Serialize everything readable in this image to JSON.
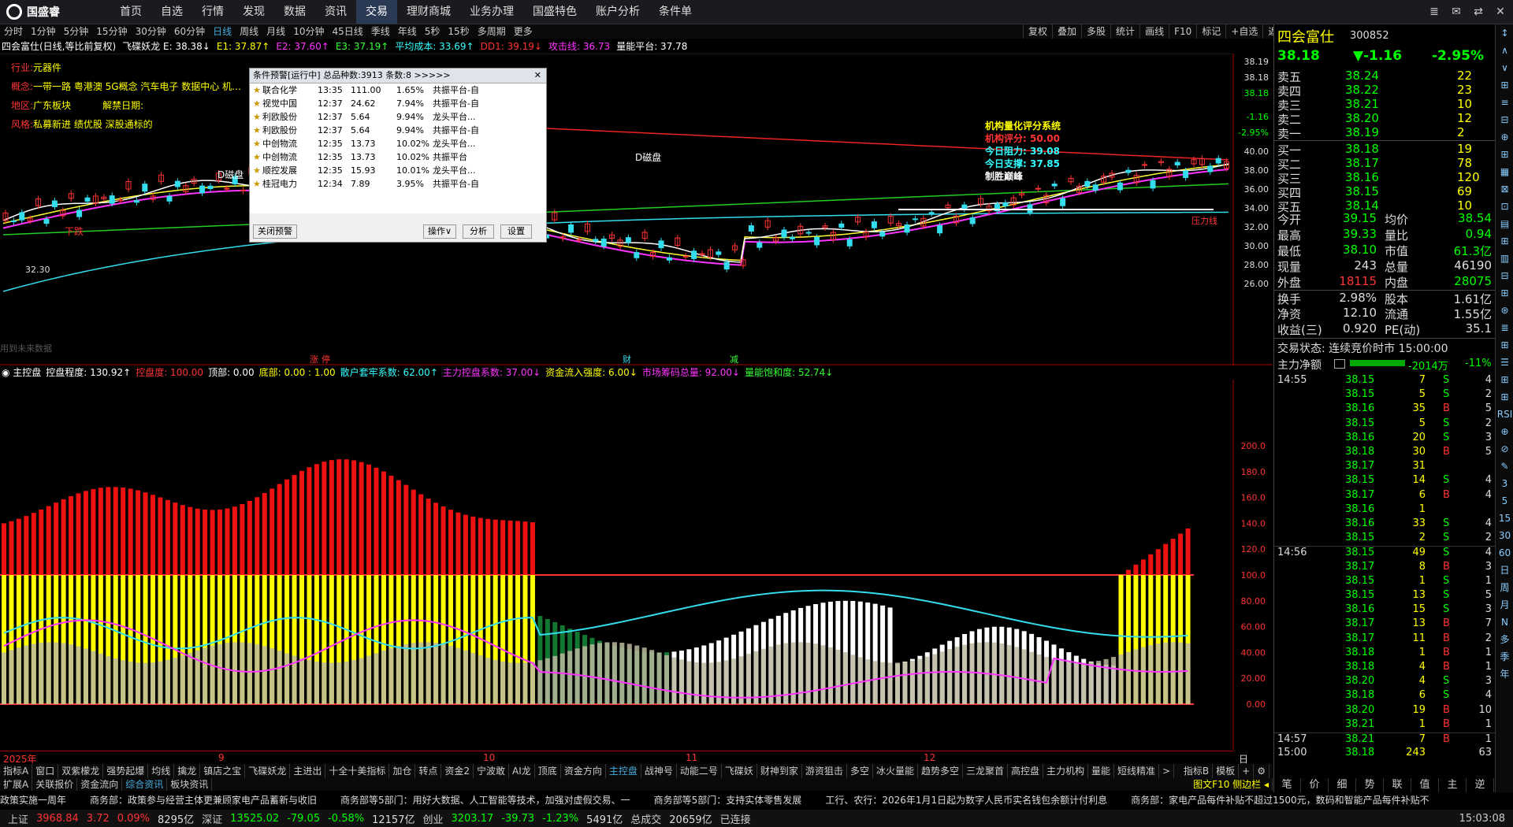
{
  "app": {
    "name": "国盛睿"
  },
  "top_nav": [
    "首页",
    "自选",
    "行情",
    "发现",
    "数据",
    "资讯",
    "交易",
    "理财商城",
    "业务办理",
    "国盛特色",
    "账户分析",
    "条件单"
  ],
  "top_nav_active": 6,
  "window_controls": [
    "≣",
    "✉",
    "⇄",
    "✕"
  ],
  "periods": [
    "分时",
    "1分钟",
    "5分钟",
    "15分钟",
    "30分钟",
    "60分钟",
    "日线",
    "周线",
    "月线",
    "10分钟",
    "45日线",
    "季线",
    "年线",
    "5秒",
    "15秒",
    "多周期",
    "更多"
  ],
  "period_active": 6,
  "chart_tools": [
    "复权",
    "叠加",
    "多股",
    "统计",
    "画线",
    "F10",
    "标记",
    "+自选",
    "返回"
  ],
  "indicator_line": [
    {
      "text": "四会富仕(日线,等比前复权)",
      "color": "#ffffff"
    },
    {
      "text": "飞碟妖龙 E: 38.38↓",
      "color": "#ffffff"
    },
    {
      "text": "E1: 37.87↑",
      "color": "#ffff00"
    },
    {
      "text": "E2: 37.60↑",
      "color": "#ff33ff"
    },
    {
      "text": "E3: 37.19↑",
      "color": "#33ff33"
    },
    {
      "text": "平均成本: 33.69↑",
      "color": "#33ffff"
    },
    {
      "text": "DD1: 39.19↓",
      "color": "#ff3333"
    },
    {
      "text": "攻击线: 36.73",
      "color": "#ff33ff"
    },
    {
      "text": "量能平台: 37.78",
      "color": "#ffffff"
    }
  ],
  "stock_info": {
    "industry_label": "行业:",
    "industry": "元器件",
    "concept_label": "概念:",
    "concept": "一带一路 粤港澳 5G概念 汽车电子 数据中心 机…",
    "region_label": "地区:",
    "region": "广东板块",
    "unlock_label": "解禁日期:",
    "style_label": "风格:",
    "style": "私募新进 绩优股 深股通标的"
  },
  "price_axis": [
    "38.19",
    "38.18",
    "38.18",
    "-1.16",
    "-2.95%",
    "40.00",
    "38.00",
    "36.00",
    "34.00",
    "32.00",
    "30.00",
    "28.00",
    "26.00"
  ],
  "chart_annotations": {
    "d_disk_1": "D磁盘",
    "d_disk_2": "D磁盘",
    "downtrend": "下跌",
    "low_mark": "32.30",
    "future_data": "用到未来数据",
    "pressure_line": "压力线",
    "markers": [
      "涨",
      "停",
      "财",
      "减"
    ]
  },
  "dialog": {
    "title": "条件预警[运行中] 总品种数:3913 条数:8 >>>>>",
    "close": "✕",
    "rows": [
      [
        "联合化学",
        "13:35",
        "111.00",
        "1.65%",
        "共振平台-自"
      ],
      [
        "视觉中国",
        "12:37",
        "24.62",
        "7.94%",
        "共振平台-自"
      ],
      [
        "利欧股份",
        "12:37",
        "5.64",
        "9.94%",
        "龙头平台..."
      ],
      [
        "利欧股份",
        "12:37",
        "5.64",
        "9.94%",
        "共振平台-自"
      ],
      [
        "中创物流",
        "12:35",
        "13.73",
        "10.02%",
        "龙头平台..."
      ],
      [
        "中创物流",
        "12:35",
        "13.73",
        "10.02%",
        "共振平台"
      ],
      [
        "顺控发展",
        "12:35",
        "15.93",
        "10.01%",
        "龙头平台..."
      ],
      [
        "桂冠电力",
        "12:34",
        "7.89",
        "3.95%",
        "共振平台-自"
      ]
    ],
    "btn_close": "关闭预警",
    "btn_op": "操作∨",
    "btn_analyze": "分析",
    "btn_settings": "设置"
  },
  "quant_box": {
    "title": "机构量化评分系统",
    "score": "机构评分: 50.00",
    "resistance": "今日阻力: 39.08",
    "support": "今日支撑: 37.85",
    "outcome": "制胜巅峰"
  },
  "lower_header": [
    {
      "text": "◉ 主控盘",
      "color": "#ffffff"
    },
    {
      "text": "控盘程度: 130.92↑",
      "color": "#ffffff"
    },
    {
      "text": "控盘度: 100.00",
      "color": "#ff3333"
    },
    {
      "text": "顶部: 0.00",
      "color": "#ffffff"
    },
    {
      "text": "底部: 0.00 : 1.00",
      "color": "#ffff00"
    },
    {
      "text": "散户套牢系数: 62.00↑",
      "color": "#33ffff"
    },
    {
      "text": "主力控盘系数: 37.00↓",
      "color": "#ff33ff"
    },
    {
      "text": "资金流入强度: 6.00↓",
      "color": "#ffff00"
    },
    {
      "text": "市场筹码总量: 92.00↓",
      "color": "#ff33ff"
    },
    {
      "text": "量能饱和度: 52.74↓",
      "color": "#33ff33"
    }
  ],
  "lower_axis": [
    "200.0",
    "180.0",
    "160.0",
    "140.0",
    "120.0",
    "100.0",
    "80.00",
    "60.00",
    "40.00",
    "20.00",
    "0.00"
  ],
  "date_axis": [
    "2025年",
    "9",
    "10",
    "11",
    "12"
  ],
  "date_period_label": "日线",
  "tabs_row1": [
    "指标A",
    "窗口",
    "双紫檬龙",
    "强势起爆",
    "均线",
    "擒龙",
    "镇店之宝",
    "飞碟妖龙",
    "主进出",
    "十全十美指标",
    "加仓",
    "转点",
    "资金2",
    "宁波敢",
    "AI龙",
    "顶底",
    "资金方向",
    "主控盘",
    "战神号",
    "动能二号",
    "飞碟妖",
    "财神到家",
    "游资狙击",
    "多空",
    "冰火量能",
    "趋势多空",
    "三龙聚首",
    "高控盘",
    "主力机构",
    "量能",
    "短线精准",
    ">"
  ],
  "tabs_row1_active": 17,
  "tabs_row1_right": [
    "指标B",
    "模板",
    "+",
    "⚙"
  ],
  "tabs_row2": [
    "扩展A",
    "关联报价",
    "资金流向",
    "综合资讯",
    "板块资讯"
  ],
  "tabs_row2_active": 3,
  "tabs_row2_right": "图文F10 侧边栏 ◂",
  "news": [
    "政策实施一周年",
    "商务部：政策参与经营主体更兼顾家电产品蓄新与收旧",
    "商务部等5部门：用好大数据、人工智能等技术，加强对虚假交易、一",
    "商务部等5部门：支持实体零售发展",
    "工行、农行：2026年1月1日起为数字人民币实名钱包余额计付利息",
    "商务部：家电产品每件补贴不超过1500元，数码和智能产品每件补贴不"
  ],
  "status": {
    "sh_label": "上证",
    "sh": "3968.84",
    "sh_chg": "3.72",
    "sh_pct": "0.09%",
    "sh_amt": "8295亿",
    "sz_label": "深证",
    "sz": "13525.02",
    "sz_chg": "-79.05",
    "sz_pct": "-0.58%",
    "sz_amt": "12157亿",
    "cy_label": "创业",
    "cy": "3203.17",
    "cy_chg": "-39.73",
    "cy_pct": "-1.23%",
    "cy_amt": "5491亿",
    "total_label": "总成交",
    "total": "20659亿",
    "conn": "已连接",
    "time": "15:03:08"
  },
  "quote": {
    "name": "四会富仕",
    "code": "300852",
    "price": "38.18",
    "change": "▼-1.16",
    "pct": "-2.95%",
    "asks": [
      [
        "卖五",
        "38.24",
        "22"
      ],
      [
        "卖四",
        "38.22",
        "23"
      ],
      [
        "卖三",
        "38.21",
        "10"
      ],
      [
        "卖二",
        "38.20",
        "12"
      ],
      [
        "卖一",
        "38.19",
        "2"
      ]
    ],
    "bids": [
      [
        "买一",
        "38.18",
        "19"
      ],
      [
        "买二",
        "38.17",
        "78"
      ],
      [
        "买三",
        "38.16",
        "120"
      ],
      [
        "买四",
        "38.15",
        "69"
      ],
      [
        "买五",
        "38.14",
        "10"
      ]
    ],
    "stats": [
      [
        "今开",
        "39.15",
        "均价",
        "38.54"
      ],
      [
        "最高",
        "39.33",
        "量比",
        "0.94"
      ],
      [
        "最低",
        "38.10",
        "市值",
        "61.3亿"
      ],
      [
        "现量",
        "243",
        "总量",
        "46190"
      ],
      [
        "外盘",
        "18115",
        "内盘",
        "28075"
      ],
      [
        "换手",
        "2.98%",
        "股本",
        "1.61亿"
      ],
      [
        "净资",
        "12.10",
        "流通",
        "1.55亿"
      ],
      [
        "收益(三)",
        "0.920",
        "PE(动)",
        "35.1"
      ]
    ],
    "trade_state": "交易状态: 连续竞价时市 15:00:00",
    "main_flow_label": "主力净额",
    "main_flow_value": "-2014万",
    "main_flow_pct": "-11%"
  },
  "ticks": [
    [
      "14:55",
      "38.15",
      "7",
      "S",
      "4"
    ],
    [
      "",
      "38.15",
      "5",
      "S",
      "2"
    ],
    [
      "",
      "38.16",
      "35",
      "B",
      "5"
    ],
    [
      "",
      "38.15",
      "5",
      "S",
      "2"
    ],
    [
      "",
      "38.16",
      "20",
      "S",
      "3"
    ],
    [
      "",
      "38.18",
      "30",
      "B",
      "5"
    ],
    [
      "",
      "38.17",
      "31",
      "",
      ""
    ],
    [
      "",
      "38.15",
      "14",
      "S",
      "4"
    ],
    [
      "",
      "38.17",
      "6",
      "B",
      "4"
    ],
    [
      "",
      "38.16",
      "1",
      "",
      ""
    ],
    [
      "",
      "38.16",
      "33",
      "S",
      "4"
    ],
    [
      "",
      "38.15",
      "2",
      "S",
      "2"
    ],
    [
      "14:56",
      "38.15",
      "49",
      "S",
      "4"
    ],
    [
      "",
      "38.17",
      "8",
      "B",
      "3"
    ],
    [
      "",
      "38.15",
      "1",
      "S",
      "1"
    ],
    [
      "",
      "38.15",
      "13",
      "S",
      "5"
    ],
    [
      "",
      "38.16",
      "15",
      "S",
      "3"
    ],
    [
      "",
      "38.17",
      "13",
      "B",
      "7"
    ],
    [
      "",
      "38.17",
      "11",
      "B",
      "2"
    ],
    [
      "",
      "38.18",
      "1",
      "B",
      "1"
    ],
    [
      "",
      "38.18",
      "4",
      "B",
      "1"
    ],
    [
      "",
      "38.20",
      "4",
      "S",
      "3"
    ],
    [
      "",
      "38.18",
      "6",
      "S",
      "4"
    ],
    [
      "",
      "38.20",
      "19",
      "B",
      "10"
    ],
    [
      "",
      "38.21",
      "1",
      "B",
      "1"
    ],
    [
      "14:57",
      "38.21",
      "7",
      "B",
      "1"
    ],
    [
      "15:00",
      "38.18",
      "243",
      "",
      "63"
    ]
  ],
  "rp_bottom_tabs": [
    "笔",
    "价",
    "细",
    "势",
    "联",
    "值",
    "主",
    "逆"
  ],
  "sidebar_icons": [
    "↕",
    "∧",
    "∨",
    "⊞",
    "≡",
    "⊟",
    "⊕",
    "⊞",
    "▦",
    "⊠",
    "⊡",
    "▤",
    "⊞",
    "▥",
    "⊟",
    "⊞",
    "⊛",
    "≣",
    "⊞",
    "☰",
    "⊞",
    "⊞",
    "RSI",
    "⊕",
    "⊘",
    "✎",
    "3",
    "5",
    "15",
    "30",
    "60",
    "日",
    "周",
    "月",
    "N",
    "多",
    "季",
    "年"
  ],
  "colors": {
    "up": "#ff3333",
    "down": "#33ff33",
    "yellow": "#ffff00",
    "cyan": "#33ffff",
    "magenta": "#ff33ff"
  }
}
